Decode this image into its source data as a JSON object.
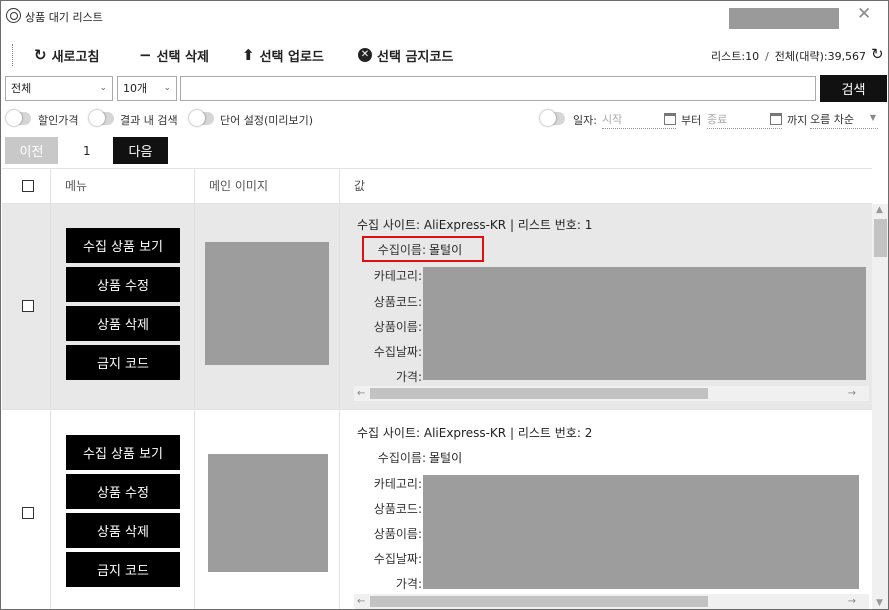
{
  "window": {
    "title": "상품 대기 리스트"
  },
  "toolbar": {
    "refresh_label": "새로고침",
    "delete_label": "선택 삭제",
    "upload_label": "선택 업로드",
    "ban_label": "선택 금지코드",
    "list_count": "리스트:10",
    "total_count": "전체(대략):39,567"
  },
  "search": {
    "category_value": "전체",
    "count_value": "10개",
    "query_value": "",
    "search_label": "검색"
  },
  "options": {
    "discount_label": "할인가격",
    "in_result_label": "결과 내 검색",
    "word_setting_label": "단어 설정(미리보기)",
    "date_label": "일자:",
    "start_placeholder": "시작",
    "from_label": "부터",
    "end_placeholder": "종료",
    "until_label": "까지",
    "sort_value": "오름 차순"
  },
  "pager": {
    "prev_label": "이전",
    "page": "1",
    "next_label": "다음"
  },
  "table": {
    "headers": {
      "menu": "메뉴",
      "image": "메인 이미지",
      "value": "값"
    },
    "action_labels": {
      "view": "수집 상품 보기",
      "edit": "상품 수정",
      "delete": "상품 삭제",
      "ban": "금지 코드"
    },
    "rows": [
      {
        "site_line": "수집 사이트: AliExpress-KR | 리스트 번호: 1",
        "collector_label": "수집이름:",
        "collector_value": "몰털이",
        "labels": [
          "카테고리:",
          "상품코드:",
          "상품이름:",
          "수집날짜:",
          "가격:"
        ],
        "selected": true,
        "highlighted": true
      },
      {
        "site_line": "수집 사이트: AliExpress-KR | 리스트 번호: 2",
        "collector_label": "수집이름:",
        "collector_value": "몰털이",
        "labels": [
          "카테고리:",
          "상품코드:",
          "상품이름:",
          "수집날짜:",
          "가격:"
        ],
        "selected": false,
        "highlighted": false
      }
    ]
  },
  "colors": {
    "highlight": "#e01010",
    "primary_button": "#000000",
    "selected_row": "#e8e8e8"
  }
}
